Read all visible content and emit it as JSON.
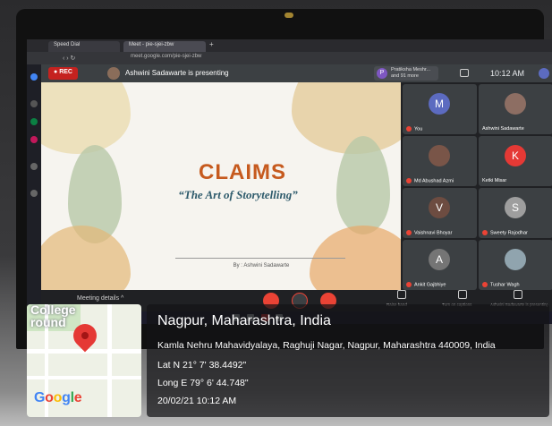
{
  "browser": {
    "tabs": [
      "Speed Dial",
      "Meet - pie-sjei-zbw"
    ],
    "url": "meet.google.com/pie-sjei-zbw"
  },
  "meet": {
    "rec_label": "REC",
    "presenting_text": "Ashwini Sadawarte is presenting",
    "people_chip_initial": "P",
    "people_chip_line1": "Pratiksha Meshr...",
    "people_chip_line2": "and 91 more",
    "clock": "10:12 AM",
    "meeting_details": "Meeting details",
    "raise_hand": "Raise hand",
    "captions": "Turn on captions",
    "presenting_label": "Ashwini Sadawarte is presenting"
  },
  "slide": {
    "title": "CLAIMS",
    "subtitle": "“The Art of Storytelling”",
    "byline": "By : Ashwini Sadawarte"
  },
  "participants": [
    {
      "name": "You",
      "initial": "M",
      "color": "#5c6bc0"
    },
    {
      "name": "Ashwini Sadawarte",
      "initial": "",
      "color": "#8d6e63"
    },
    {
      "name": "Md Abushad Azmi",
      "initial": "",
      "color": "#795548"
    },
    {
      "name": "Ketki Misar",
      "initial": "K",
      "color": "#e53935"
    },
    {
      "name": "Vaishnavi Bhoyar",
      "initial": "V",
      "color": "#6d4c41"
    },
    {
      "name": "Sweety Rajodhar",
      "initial": "S",
      "color": "#9e9e9e"
    },
    {
      "name": "Ankit Gajbhiye",
      "initial": "A",
      "color": "#757575"
    },
    {
      "name": "Tushar Wagh",
      "initial": "",
      "color": "#90a4ae"
    }
  ],
  "geotag": {
    "map_label_1": "College",
    "map_label_2": "round",
    "brand": "Google",
    "city": "Nagpur, Maharashtra, India",
    "address": "Kamla Nehru Mahavidyalaya, Raghuji Nagar, Nagpur, Maharashtra 440009, India",
    "lat": "Lat N 21° 7' 38.4492\"",
    "long": "Long E 79° 6' 44.748\"",
    "datetime": "20/02/21 10:12 AM"
  }
}
